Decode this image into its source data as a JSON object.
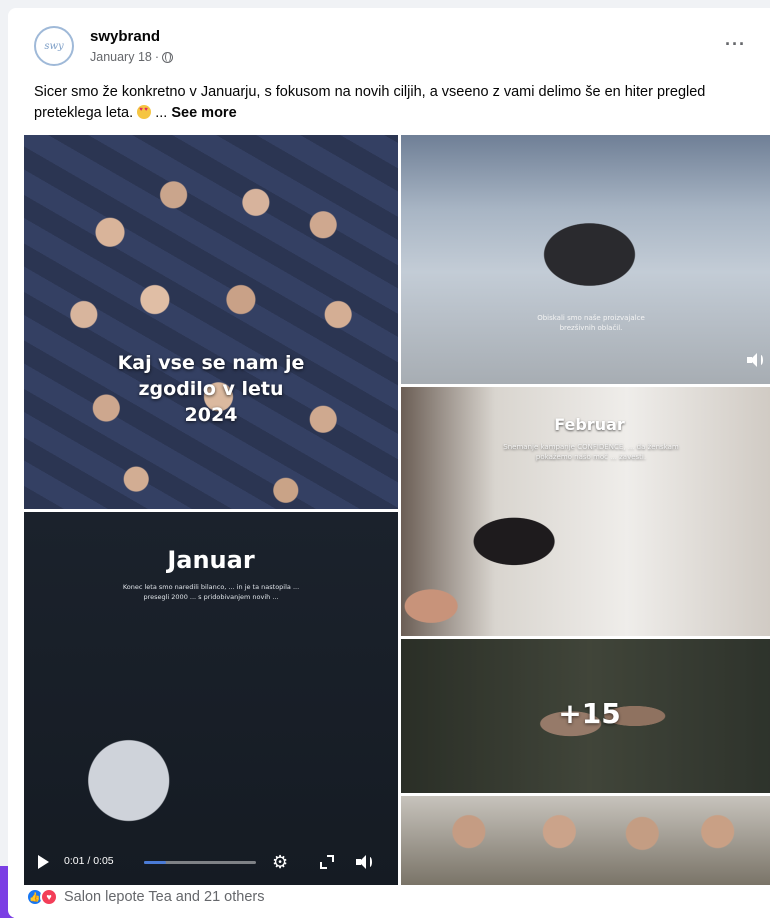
{
  "post": {
    "author": "swybrand",
    "avatar_text": "swy",
    "date": "January 18",
    "separator": "·",
    "more_label": "···",
    "text_main": "Sicer smo že konkretno v Januarju, s fokusom na novih ciljih, a vseeno z vami delimo še en hiter pregled preteklega leta.",
    "text_ellipsis": "...",
    "see_more": "See more"
  },
  "media": {
    "tile1": {
      "title_line1": "Kaj vse se nam je",
      "title_line2": "zgodilo v letu",
      "title_line3": "2024"
    },
    "tile2": {
      "caption": "Obiskali smo naše proizvajalce brezšivnih oblačil."
    },
    "tile3": {
      "title": "Februar",
      "caption": "Snemanje kampanje CONFIDENCE, ... da ženskam pokažemo našo moč ... zavesti."
    },
    "tile4": {
      "title": "Januar",
      "caption": "Konec leta smo naredili bilanco, ... in je ta nastopila ... presegli 2000 ... s pridobivanjem novih ... ",
      "time": "0:01 / 0:05",
      "progress": 0.2
    },
    "tile6_more": "+15"
  },
  "icons": {
    "avatar": "swybrand-logo",
    "globe": "globe-icon",
    "emoji": "heart-eyes-emoji-icon",
    "play": "play-icon",
    "gear": "gear-icon",
    "fullscreen": "fullscreen-icon",
    "mute": "mute-icon",
    "like": "like-icon",
    "love": "love-icon"
  },
  "colors": {
    "accent": "#1877f2",
    "love": "#f33e58",
    "side_tab": "#7b3fe4",
    "secondary_text": "#65676b",
    "progress": "#4a7bd6"
  },
  "reactions": {
    "text": "Salon lepote Tea and 21 others"
  }
}
